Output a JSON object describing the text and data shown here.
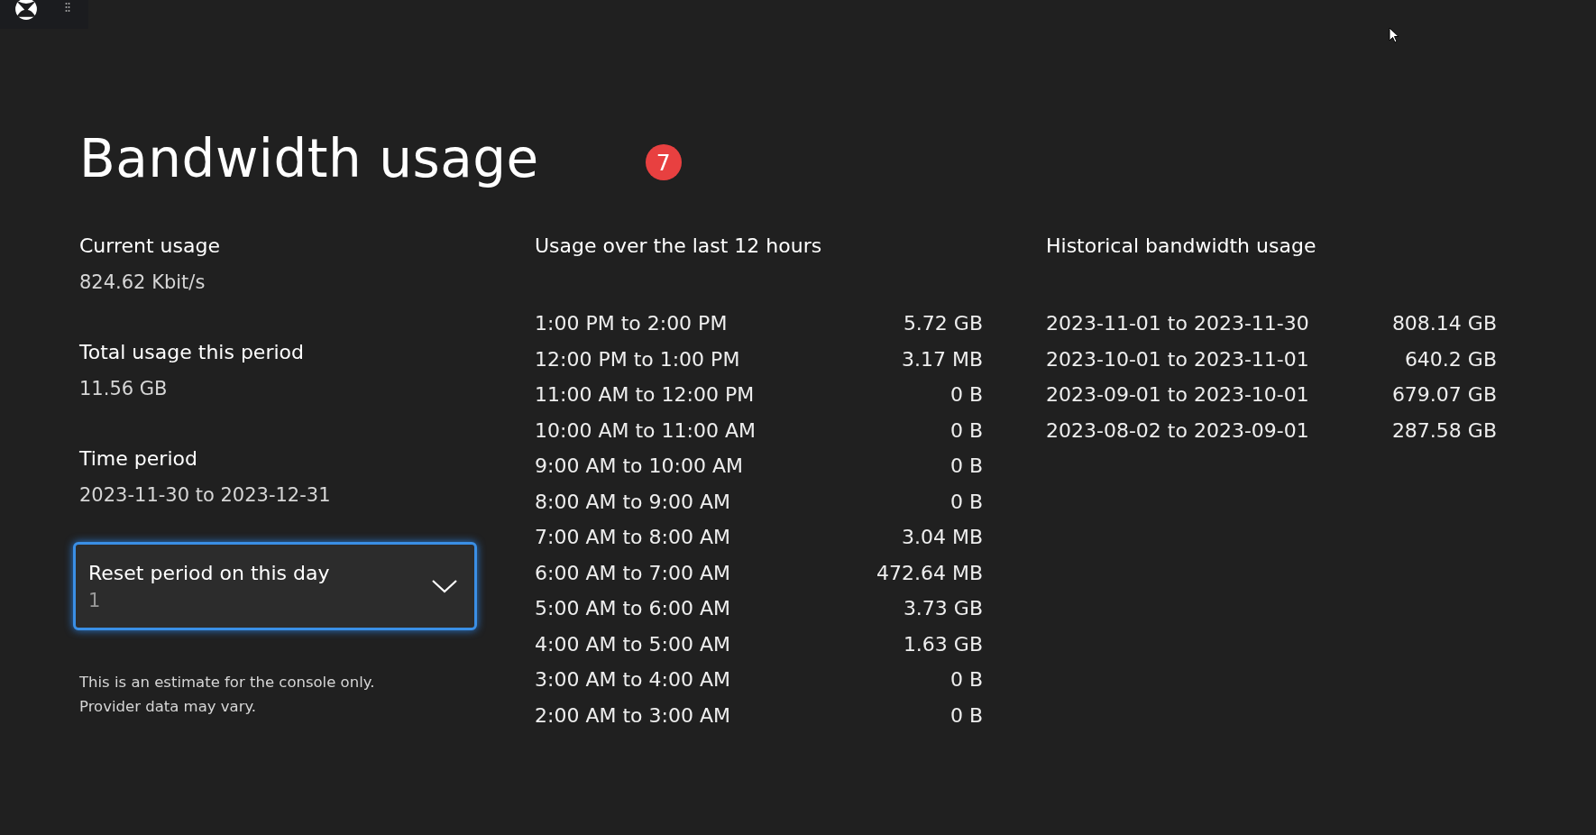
{
  "title": "Bandwidth usage",
  "step_badge": "7",
  "current_usage": {
    "label": "Current usage",
    "value": "824.62 Kbit/s"
  },
  "total_usage": {
    "label": "Total usage this period",
    "value": "11.56 GB"
  },
  "time_period": {
    "label": "Time period",
    "value": "2023-11-30 to 2023-12-31"
  },
  "reset_dropdown": {
    "label": "Reset period on this day",
    "value": "1"
  },
  "note": [
    "This is an estimate for the console only.",
    "Provider data may vary."
  ],
  "recent": {
    "heading": "Usage over the last 12 hours",
    "rows": [
      {
        "period": "1:00 PM to 2:00 PM",
        "amount": "5.72 GB"
      },
      {
        "period": "12:00 PM to 1:00 PM",
        "amount": "3.17 MB"
      },
      {
        "period": "11:00 AM to 12:00 PM",
        "amount": "0 B"
      },
      {
        "period": "10:00 AM to 11:00 AM",
        "amount": "0 B"
      },
      {
        "period": "9:00 AM to 10:00 AM",
        "amount": "0 B"
      },
      {
        "period": "8:00 AM to 9:00 AM",
        "amount": "0 B"
      },
      {
        "period": "7:00 AM to 8:00 AM",
        "amount": "3.04 MB"
      },
      {
        "period": "6:00 AM to 7:00 AM",
        "amount": "472.64 MB"
      },
      {
        "period": "5:00 AM to 6:00 AM",
        "amount": "3.73 GB"
      },
      {
        "period": "4:00 AM to 5:00 AM",
        "amount": "1.63 GB"
      },
      {
        "period": "3:00 AM to 4:00 AM",
        "amount": "0 B"
      },
      {
        "period": "2:00 AM to 3:00 AM",
        "amount": "0 B"
      }
    ]
  },
  "historical": {
    "heading": "Historical bandwidth usage",
    "rows": [
      {
        "period": "2023-11-01 to 2023-11-30",
        "amount": "808.14 GB"
      },
      {
        "period": "2023-10-01 to 2023-11-01",
        "amount": "640.2 GB"
      },
      {
        "period": "2023-09-01 to 2023-10-01",
        "amount": "679.07 GB"
      },
      {
        "period": "2023-08-02 to 2023-09-01",
        "amount": "287.58 GB"
      }
    ]
  }
}
